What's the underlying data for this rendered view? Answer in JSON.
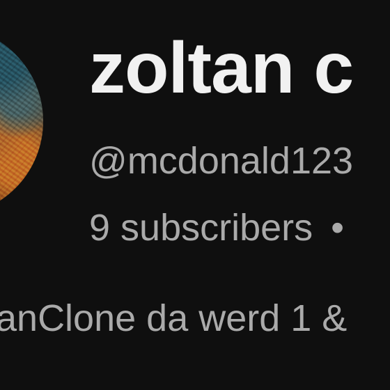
{
  "channel": {
    "name": "zoltan c",
    "handle": "@mcdonald123",
    "subscribers": "9 subscribers",
    "meta_separator": "•",
    "description": "anClone da werd 1 &"
  },
  "colors": {
    "background": "#0f0f0f",
    "title_text": "#f1f1f1",
    "secondary_text": "#aaaaaa"
  }
}
